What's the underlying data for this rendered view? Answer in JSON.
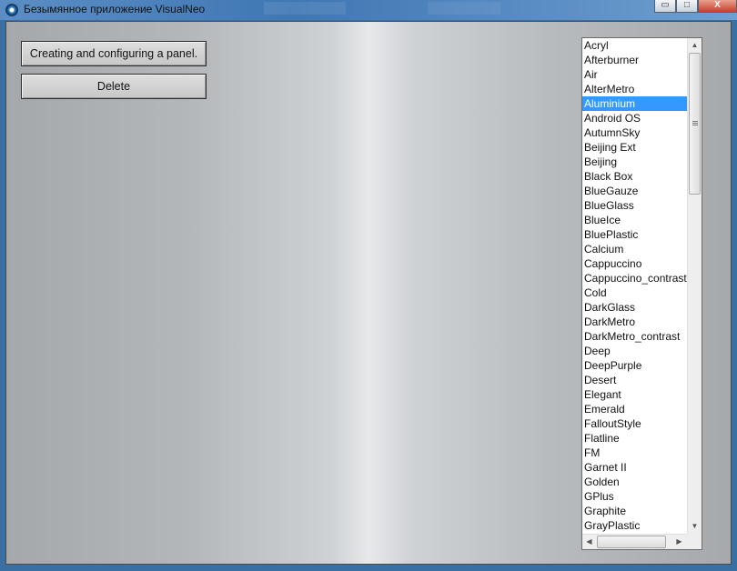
{
  "window": {
    "title": "Безымянное приложение VisualNeo",
    "minimize_glyph": "▭",
    "maximize_glyph": "□",
    "close_glyph": "X"
  },
  "buttons": {
    "create_panel": "Creating and configuring a panel.",
    "delete": "Delete"
  },
  "skins_list": {
    "selected": "Aluminium",
    "items": [
      "Acryl",
      "Afterburner",
      "Air",
      "AlterMetro",
      "Aluminium",
      "Android OS",
      "AutumnSky",
      "Beijing Ext",
      "Beijing",
      "Black Box",
      "BlueGauze",
      "BlueGlass",
      "BlueIce",
      "BluePlastic",
      "Calcium",
      "Cappuccino",
      "Cappuccino_contrast",
      "Cold",
      "DarkGlass",
      "DarkMetro",
      "DarkMetro_contrast",
      "Deep",
      "DeepPurple",
      "Desert",
      "Elegant",
      "Emerald",
      "FalloutStyle",
      "Flatline",
      "FM",
      "Garnet II",
      "Golden",
      "GPlus",
      "Graphite",
      "GrayPlastic"
    ]
  },
  "scrollbars": {
    "up_arrow": "▲",
    "down_arrow": "▼",
    "left_arrow": "◀",
    "right_arrow": "▶"
  }
}
